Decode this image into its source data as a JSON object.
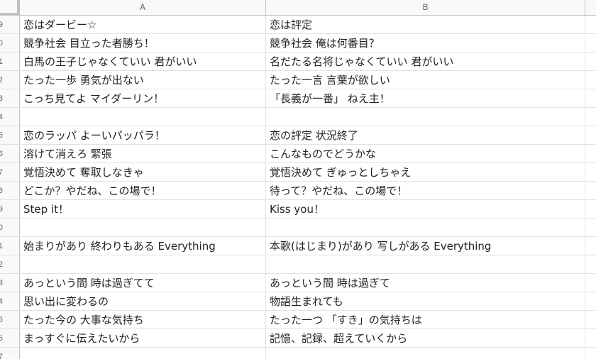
{
  "columns": [
    "A",
    "B"
  ],
  "rows": [
    {
      "num": "9",
      "a": "恋はダービー☆",
      "b": "恋は評定"
    },
    {
      "num": "0",
      "a": "競争社会 目立った者勝ち！",
      "b": "競争社会 俺は何番目？"
    },
    {
      "num": "1",
      "a": "白馬の王子じゃなくていい 君がいい",
      "b": "名だたる名将じゃなくていい 君がいい"
    },
    {
      "num": "2",
      "a": "たった一歩 勇気が出ない",
      "b": "たった一言 言葉が欲しい"
    },
    {
      "num": "3",
      "a": "こっち見てよ マイダーリン！",
      "b": "「長義が一番」 ねえ主！"
    },
    {
      "num": "4",
      "a": "",
      "b": ""
    },
    {
      "num": "5",
      "a": "恋のラッパ よーいパッパラ！",
      "b": "恋の評定 状況終了"
    },
    {
      "num": "6",
      "a": "溶けて消えろ 緊張",
      "b": "こんなものでどうかな"
    },
    {
      "num": "7",
      "a": "覚悟決めて 奪取しなきゃ",
      "b": "覚悟決めて ぎゅっとしちゃえ"
    },
    {
      "num": "8",
      "a": "どこか？やだね、この場で！",
      "b": "待って？やだね、この場で！"
    },
    {
      "num": "9",
      "a": "Step it！",
      "b": "Kiss you！"
    },
    {
      "num": "0",
      "a": "",
      "b": ""
    },
    {
      "num": "1",
      "a": "始まりがあり 終わりもある Everything",
      "b": "本歌(はじまり)があり 写しがある Everything"
    },
    {
      "num": "2",
      "a": "",
      "b": ""
    },
    {
      "num": "3",
      "a": "あっという間 時は過ぎてて",
      "b": "あっという間 時は過ぎて"
    },
    {
      "num": "4",
      "a": "思い出に変わるの",
      "b": "物語生まれても"
    },
    {
      "num": "5",
      "a": "たった今の 大事な気持ち",
      "b": "たった一つ 「すき」の気持ちは"
    },
    {
      "num": "6",
      "a": "まっすぐに伝えたいから",
      "b": "記憶、記録、超えていくから"
    },
    {
      "num": "7",
      "a": "",
      "b": ""
    }
  ]
}
